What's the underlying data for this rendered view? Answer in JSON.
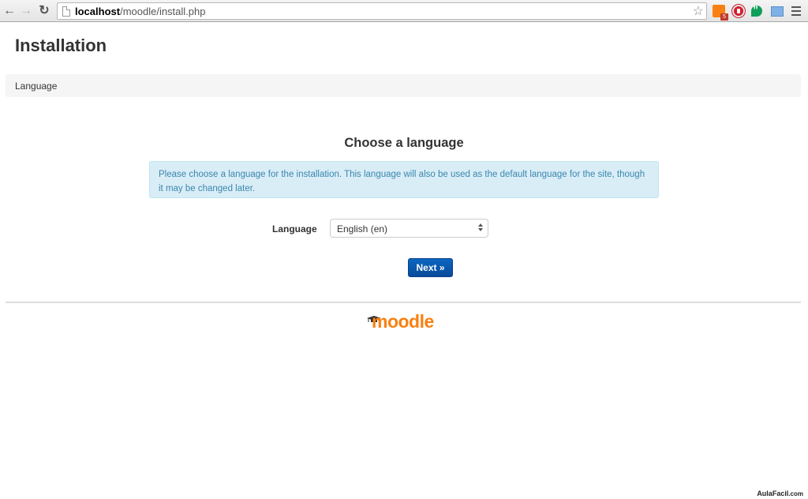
{
  "browser": {
    "url_host": "localhost",
    "url_path": "/moodle/install.php",
    "extension_badge": "5",
    "icons": {
      "back": "arrow-left-icon",
      "forward": "arrow-right-icon",
      "reload": "reload-icon",
      "page": "page-icon",
      "bookmark": "star-icon",
      "menu": "hamburger-menu-icon"
    }
  },
  "page": {
    "title": "Installation",
    "nav_strip_label": "Language",
    "heading": "Choose a language",
    "info_text": "Please choose a language for the installation. This language will also be used as the default language for the site, though it may be changed later.",
    "form": {
      "language_label": "Language",
      "language_selected": "English (en)"
    },
    "next_button": "Next »",
    "footer_logo_text": "moodle"
  },
  "watermark": {
    "text": "AulaFacil",
    "suffix": ".com"
  },
  "colors": {
    "info_bg": "#d9edf7",
    "info_text": "#3a87ad",
    "button_primary": "#0a5bb0",
    "moodle_orange": "#f98012"
  }
}
